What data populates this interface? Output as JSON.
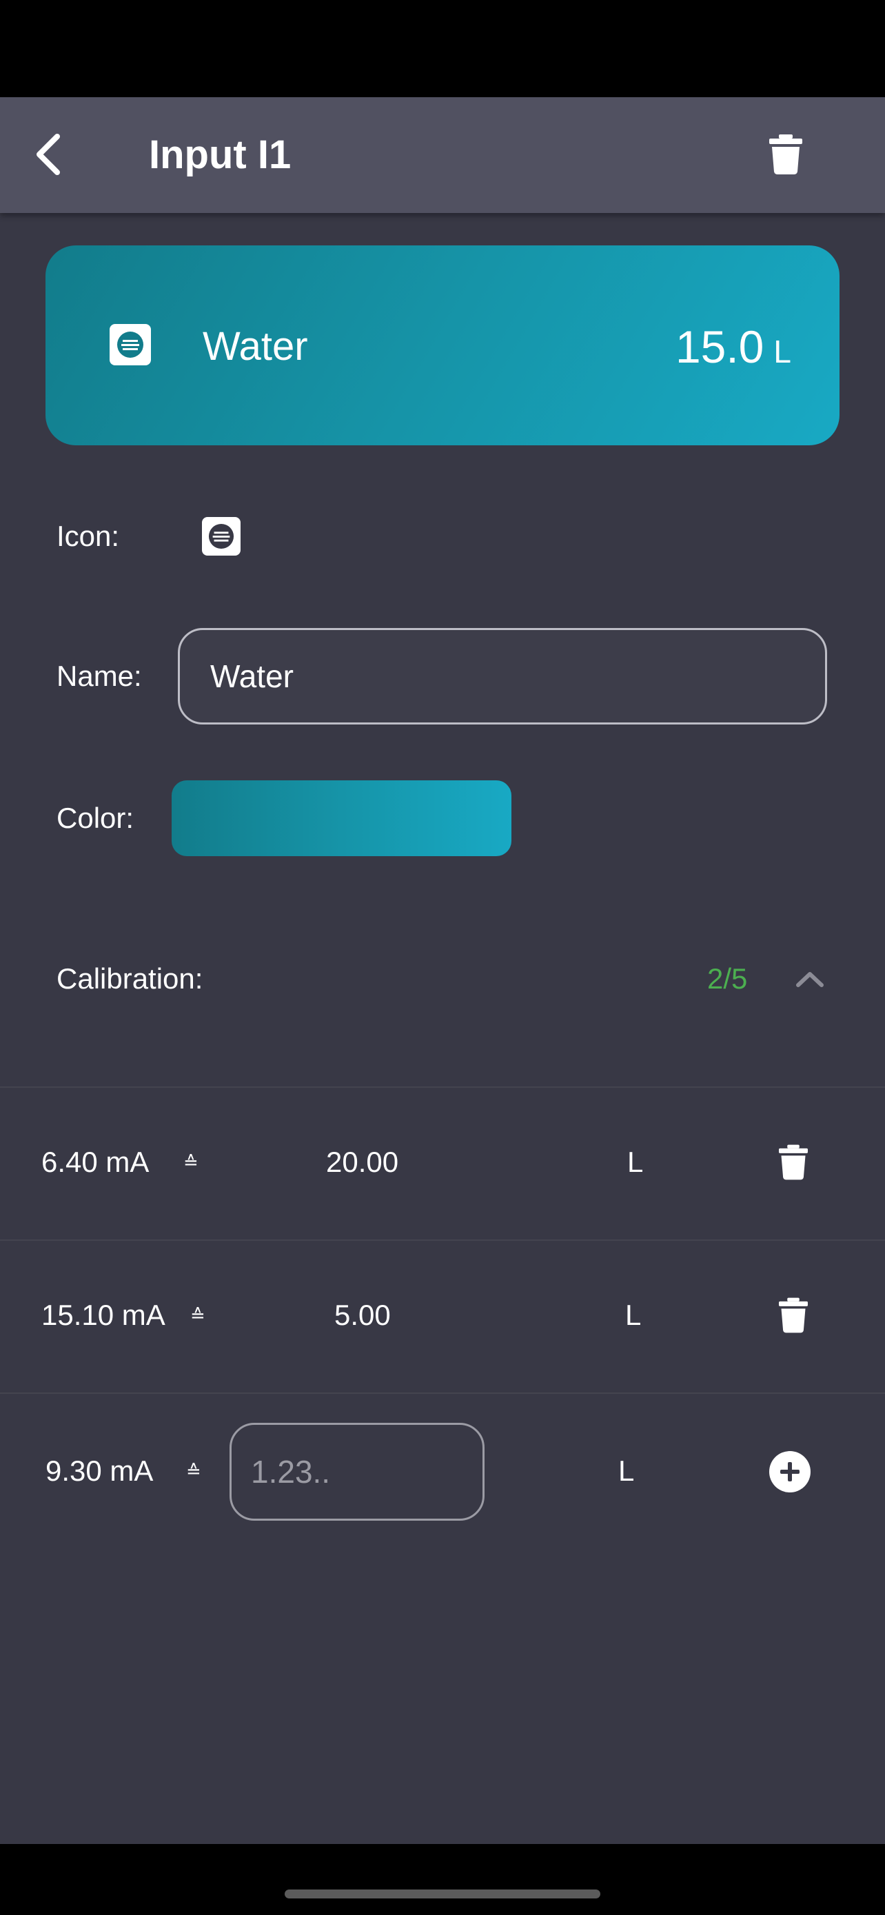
{
  "appbar": {
    "title": "Input I1",
    "back_icon": "chevron-left-icon",
    "delete_icon": "trash-icon"
  },
  "preview": {
    "icon": "water-meter-icon",
    "name": "Water",
    "value": "15.0",
    "unit": "L",
    "gradient": [
      "#127c8b",
      "#18a9c4"
    ]
  },
  "form": {
    "icon_label": "Icon:",
    "icon": "water-meter-icon",
    "name_label": "Name:",
    "name_value": "Water",
    "color_label": "Color:",
    "color": [
      "#127c8b",
      "#18a9c4"
    ]
  },
  "calibration": {
    "label": "Calibration:",
    "count": "2/5",
    "count_color": "#4caf50",
    "toggle_icon": "chevron-up-icon",
    "rows": [
      {
        "input": "6.40 mA",
        "approx": "≙",
        "value": "20.00",
        "unit": "L",
        "action_icon": "trash-icon"
      },
      {
        "input": "15.10 mA",
        "approx": "≙",
        "value": "5.00",
        "unit": "L",
        "action_icon": "trash-icon"
      }
    ],
    "new_row": {
      "input": "9.30 mA",
      "approx": "≙",
      "placeholder": "1.23..",
      "unit": "L",
      "action_icon": "plus-circle-icon"
    }
  }
}
